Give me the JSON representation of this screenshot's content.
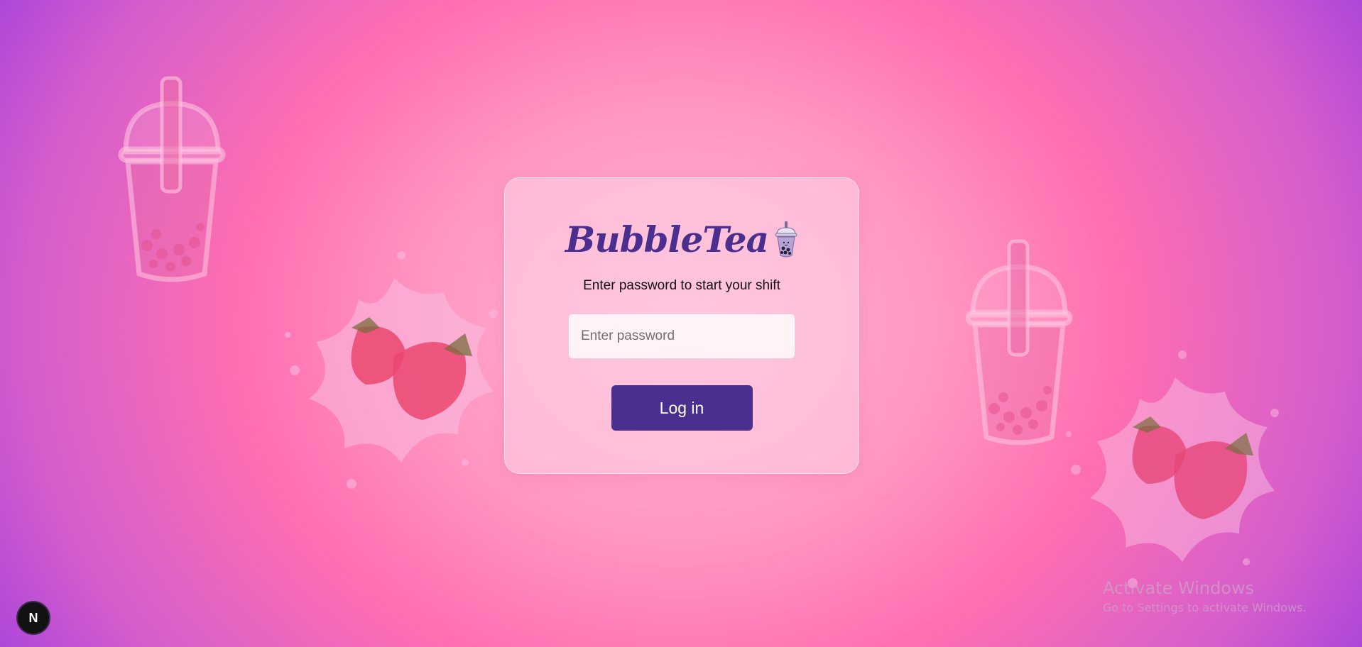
{
  "brand": {
    "name": "BubbleTea",
    "logo_icon": "bubble-tea-cup-icon",
    "color": "#4a2f8e"
  },
  "login": {
    "subtitle": "Enter password to start your shift",
    "password_placeholder": "Enter password",
    "password_value": "",
    "button_label": "Log in"
  },
  "badge": {
    "label": "N",
    "icon": "nextjs-logo-icon"
  },
  "watermark": {
    "title": "Activate Windows",
    "subtitle": "Go to Settings to activate Windows."
  },
  "decorations": [
    "bubble-tea-cup-icon",
    "strawberry-splash-icon"
  ],
  "colors": {
    "background_center": "#ffb6d3",
    "background_mid": "#ff6fb0",
    "background_edge": "#9a3be0",
    "button": "#4a2f8e"
  }
}
